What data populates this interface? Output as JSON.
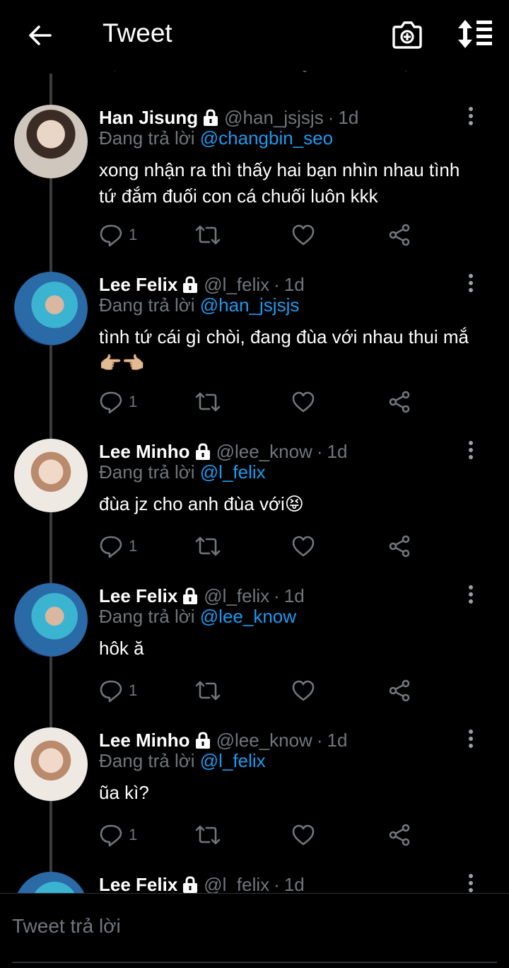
{
  "header": {
    "title": "Tweet",
    "back_icon": "arrow-left-icon",
    "camera_icon": "camera-add-icon",
    "sort_icon": "sort-icon"
  },
  "colors": {
    "background": "#000000",
    "text": "#ffffff",
    "muted": "#71767b",
    "mention": "#1d9bf0",
    "thread_line": "#3b3b3b"
  },
  "tweets": [
    {
      "name": "Han Jisung",
      "handle": "@han_jsjsjs",
      "time": "1d",
      "reply_prefix": "Đang trả lời ",
      "reply_to": "@changbin_seo",
      "text": "xong nhận ra thì thấy hai bạn nhìn nhau tình tứ đắm đuối con cá chuối luôn kkk",
      "reply_count": "1"
    },
    {
      "name": "Lee Felix",
      "handle": "@l_felix",
      "time": "1d",
      "reply_prefix": "Đang trả lời ",
      "reply_to": "@han_jsjsjs",
      "text": "tình tứ cái gì chòi, đang đùa với nhau thui mắ👉🏼👈🏼",
      "reply_count": "1"
    },
    {
      "name": "Lee Minho",
      "handle": "@lee_know",
      "time": "1d",
      "reply_prefix": "Đang trả lời ",
      "reply_to": "@l_felix",
      "text": "đùa jz cho anh đùa với😝",
      "reply_count": "1"
    },
    {
      "name": "Lee Felix",
      "handle": "@l_felix",
      "time": "1d",
      "reply_prefix": "Đang trả lời ",
      "reply_to": "@lee_know",
      "text": "hôk ă",
      "reply_count": "1"
    },
    {
      "name": "Lee Minho",
      "handle": "@lee_know",
      "time": "1d",
      "reply_prefix": "Đang trả lời ",
      "reply_to": "@l_felix",
      "text": "ũa kì?",
      "reply_count": "1"
    },
    {
      "name": "Lee Felix",
      "handle": "@l_felix",
      "time": "1d"
    }
  ],
  "compose": {
    "placeholder": "Tweet trả lời"
  }
}
